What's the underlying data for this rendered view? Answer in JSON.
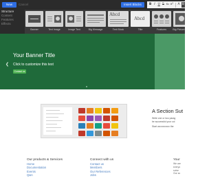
{
  "toolbar": {
    "new_label": "New",
    "cancel_label": "Cancel",
    "insert_label": "Insert Blocks",
    "format_buttons": [
      "B",
      "I",
      "U",
      "S",
      "x₂",
      "x²",
      "A",
      "B"
    ],
    "side_menu": [
      "Structure",
      "Content",
      "Features",
      "Effects"
    ],
    "blocks": [
      {
        "label": "Banner"
      },
      {
        "label": "Text Image"
      },
      {
        "label": "Image Text"
      },
      {
        "label": "Big Message"
      },
      {
        "label": "Text Block",
        "sample": "Abcd"
      },
      {
        "label": "Title",
        "sample": "Abcd"
      },
      {
        "label": "Features"
      },
      {
        "label": "Big Picture"
      }
    ]
  },
  "banner": {
    "title": "Your Banner Title",
    "subtitle": "Click to customize this text",
    "button_label": "Contact us",
    "bg_color": "#2f7f4e"
  },
  "section": {
    "title": "A Section Sut",
    "text_line1": "Write one or two parag",
    "text_line2": "be successful your col",
    "text_line3": "Start wcxxxxxxxx the"
  },
  "footer": {
    "col1": {
      "heading": "Our products & Services",
      "links": [
        "Home",
        "Documentation",
        "Events",
        "Q&A"
      ]
    },
    "col2": {
      "heading": "Connect with us",
      "links": [
        "Contact us",
        "Members",
        "Our References",
        "Jobs"
      ]
    },
    "col3": {
      "heading": "Your",
      "lines": [
        "We are",
        "everyo",
        "solve",
        "Our so"
      ]
    }
  }
}
